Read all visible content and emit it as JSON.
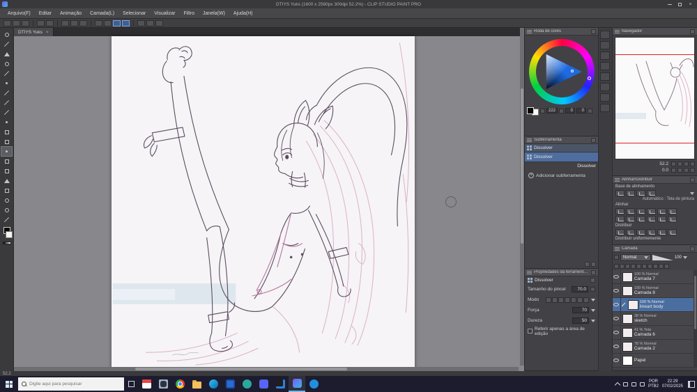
{
  "window": {
    "title": "DTIYS Yuks (1600 x 2560px 300dpi 52.2%)  - CLIP STUDIO PAINT PRO",
    "menu": {
      "items": [
        "Arquivo(F)",
        "Editar",
        "Animação",
        "Camada(L)",
        "Selecionar",
        "Visualizar",
        "Filtro",
        "Janela(W)",
        "Ajuda(H)"
      ]
    }
  },
  "tabbar": {
    "tab": "DTIYS Yuks",
    "close": "×"
  },
  "statusbar": {
    "zoom": "52.2"
  },
  "color_panel": {
    "title": "Roda de cores",
    "value": "222",
    "v2": "0",
    "v3": "0"
  },
  "subtool_panel": {
    "title": "Subferramenta",
    "item1": "Dissolver",
    "item2": "Dissolver",
    "tooltip": "Dissolver",
    "add": "Adicionar subferramenta"
  },
  "props_panel": {
    "title": "Propriedades da ferramenta: Dissol",
    "tool": "Dissolver",
    "rows": [
      {
        "label": "Tamanho do pincel",
        "value": "70.0"
      },
      {
        "label": "Modo",
        "value": ""
      },
      {
        "label": "Força",
        "value": "70"
      },
      {
        "label": "Dureza",
        "value": "50"
      }
    ],
    "checkbox": "Referir apenas a área de edição"
  },
  "navigator": {
    "title": "Navegador",
    "zoom": "52.2",
    "rotation": "0.0"
  },
  "align_panel": {
    "title": "Alinhar/Distribuir",
    "base": "Base de alinhamento",
    "auto": "Automático : Tela de pintura",
    "align": "Alinhar",
    "distribute": "Distribuir",
    "uniform": "Distribuir uniformemente"
  },
  "layers_panel": {
    "title": "Camada",
    "mode": "Normal",
    "opacity": "100",
    "items": [
      {
        "meta": "100 % Normal",
        "name": "Camada 7"
      },
      {
        "meta": "100 % Normal",
        "name": "Camada 8"
      },
      {
        "meta": "100 % Normal",
        "name": "lineart body"
      },
      {
        "meta": "38 % Normal",
        "name": "sketch"
      },
      {
        "meta": "41 % Tela",
        "name": "Camada 6"
      },
      {
        "meta": "78 % Normal",
        "name": "Camada 2"
      },
      {
        "meta": "",
        "name": "Papel"
      }
    ]
  },
  "taskbar": {
    "search_placeholder": "Digite aqui para pesquisar",
    "lang_top": "POR",
    "lang_bottom": "PTB2",
    "time": "22:29",
    "date": "07/02/2025"
  }
}
